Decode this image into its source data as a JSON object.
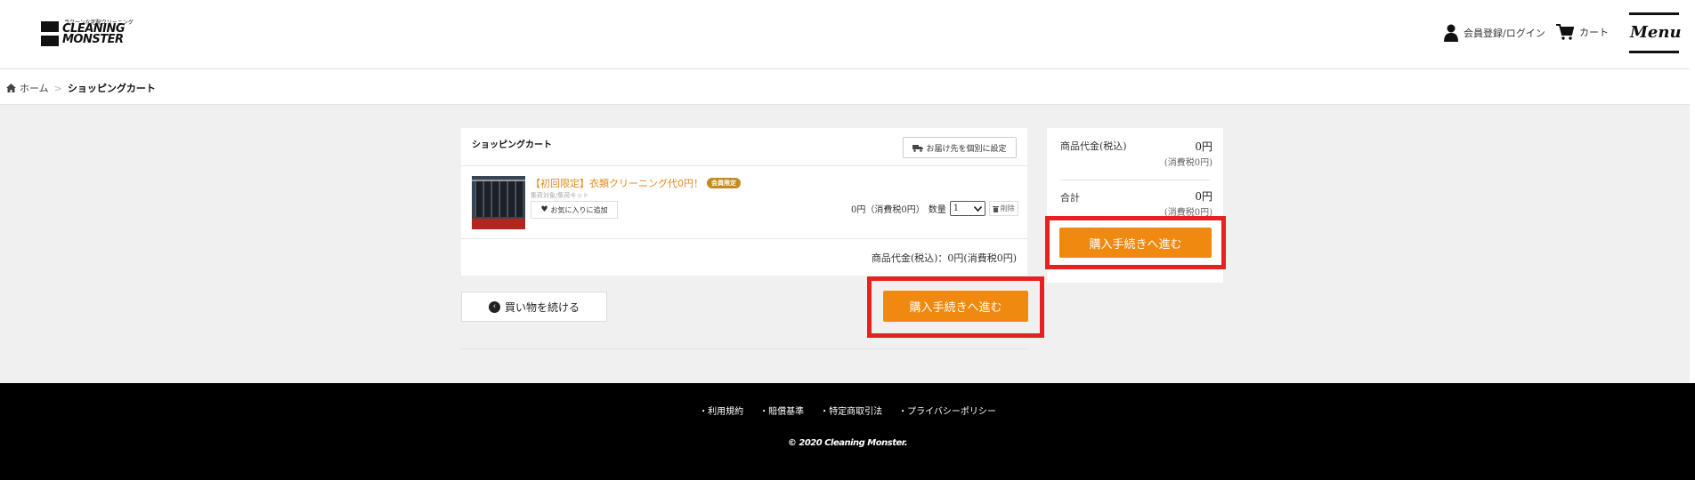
{
  "header": {
    "logo_tagline": "ラクーンな宅配クリーニング",
    "logo_line1": "CLEANING",
    "logo_line2": "MONSTER",
    "register_login": "会員登録/ログイン",
    "cart": "カート",
    "menu": "Menu"
  },
  "breadcrumb": {
    "home": "ホーム",
    "separator": ">",
    "current": "ショッピングカート"
  },
  "cart": {
    "title": "ショッピングカート",
    "ship_button": "お届け先を個別に設定",
    "item": {
      "name": "【初回限定】衣類クリーニング代0円！",
      "badge": "会員限定",
      "subtitle": "集荷対象/集荷キット",
      "favorite_button": "お気に入りに追加",
      "price": "0円（消費税0円）",
      "qty_label": "数量",
      "qty_value": "1",
      "delete_button": "削除"
    },
    "subtotal": "商品代金(税込)：0円(消費税0円)"
  },
  "continue_button": "買い物を続ける",
  "checkout_button": "購入手続きへ進む",
  "summary": {
    "product_label": "商品代金(税込)",
    "product_value": "0円",
    "product_tax": "(消費税0円)",
    "total_label": "合計",
    "total_value": "0円",
    "total_tax": "(消費税0円)"
  },
  "footer": {
    "links": [
      "利用規約",
      "賠償基準",
      "特定商取引法",
      "プライバシーポリシー"
    ],
    "copyright": "© 2020 Cleaning Monster."
  },
  "colors": {
    "accent_orange": "#f0890f",
    "highlight_red": "#e52122",
    "product_link": "#e2891c",
    "footer_bg": "#000000"
  }
}
